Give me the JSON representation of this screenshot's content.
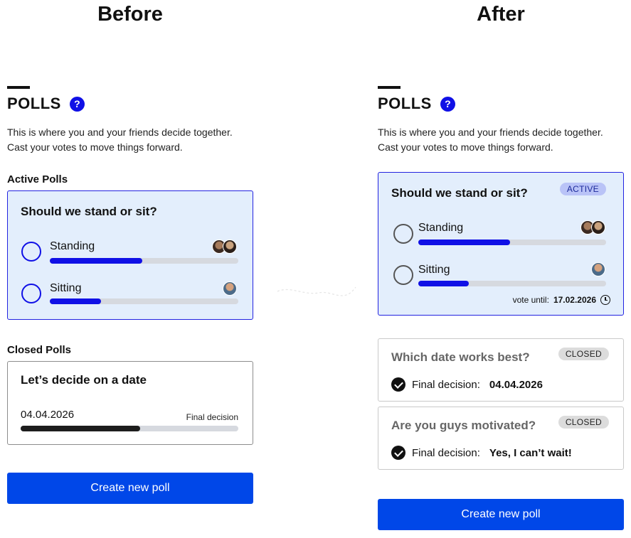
{
  "columns": {
    "before": "Before",
    "after": "After"
  },
  "polls": {
    "title": "POLLS",
    "help_glyph": "?",
    "intro_line1": "This is where you and your friends decide together.",
    "intro_line2": "Cast your votes to move things forward."
  },
  "before": {
    "active_label": "Active Polls",
    "closed_label": "Closed Polls",
    "active_poll": {
      "question": "Should we stand or sit?",
      "options": [
        {
          "label": "Standing",
          "fraction": 0.49
        },
        {
          "label": "Sitting",
          "fraction": 0.27
        }
      ]
    },
    "closed_poll": {
      "question": "Let’s decide on a date",
      "result": "04.04.2026",
      "result_caption": "Final decision",
      "fraction": 0.55
    },
    "create_button": "Create new poll"
  },
  "after": {
    "active_poll": {
      "question": "Should we stand or sit?",
      "badge": "ACTIVE",
      "options": [
        {
          "label": "Standing",
          "fraction": 0.49
        },
        {
          "label": "Sitting",
          "fraction": 0.27
        }
      ],
      "vote_until_label": "vote until:",
      "vote_until_date": "17.02.2026"
    },
    "closed_polls": [
      {
        "question": "Which date works best?",
        "badge": "CLOSED",
        "decision_label": "Final decision:",
        "decision_value": "04.04.2026"
      },
      {
        "question": "Are you guys motivated?",
        "badge": "CLOSED",
        "decision_label": "Final decision:",
        "decision_value": "Yes, I can’t wait!"
      }
    ],
    "create_button": "Create new poll"
  },
  "colors": {
    "accent": "#1010e6",
    "button": "#0047e8",
    "active_card_bg": "#e3eefc",
    "active_badge": "#b9c3f7",
    "closed_badge": "#dcdcdc"
  },
  "icons": [
    "help-icon",
    "radio-icon",
    "avatar",
    "clock-icon",
    "check-icon"
  ]
}
